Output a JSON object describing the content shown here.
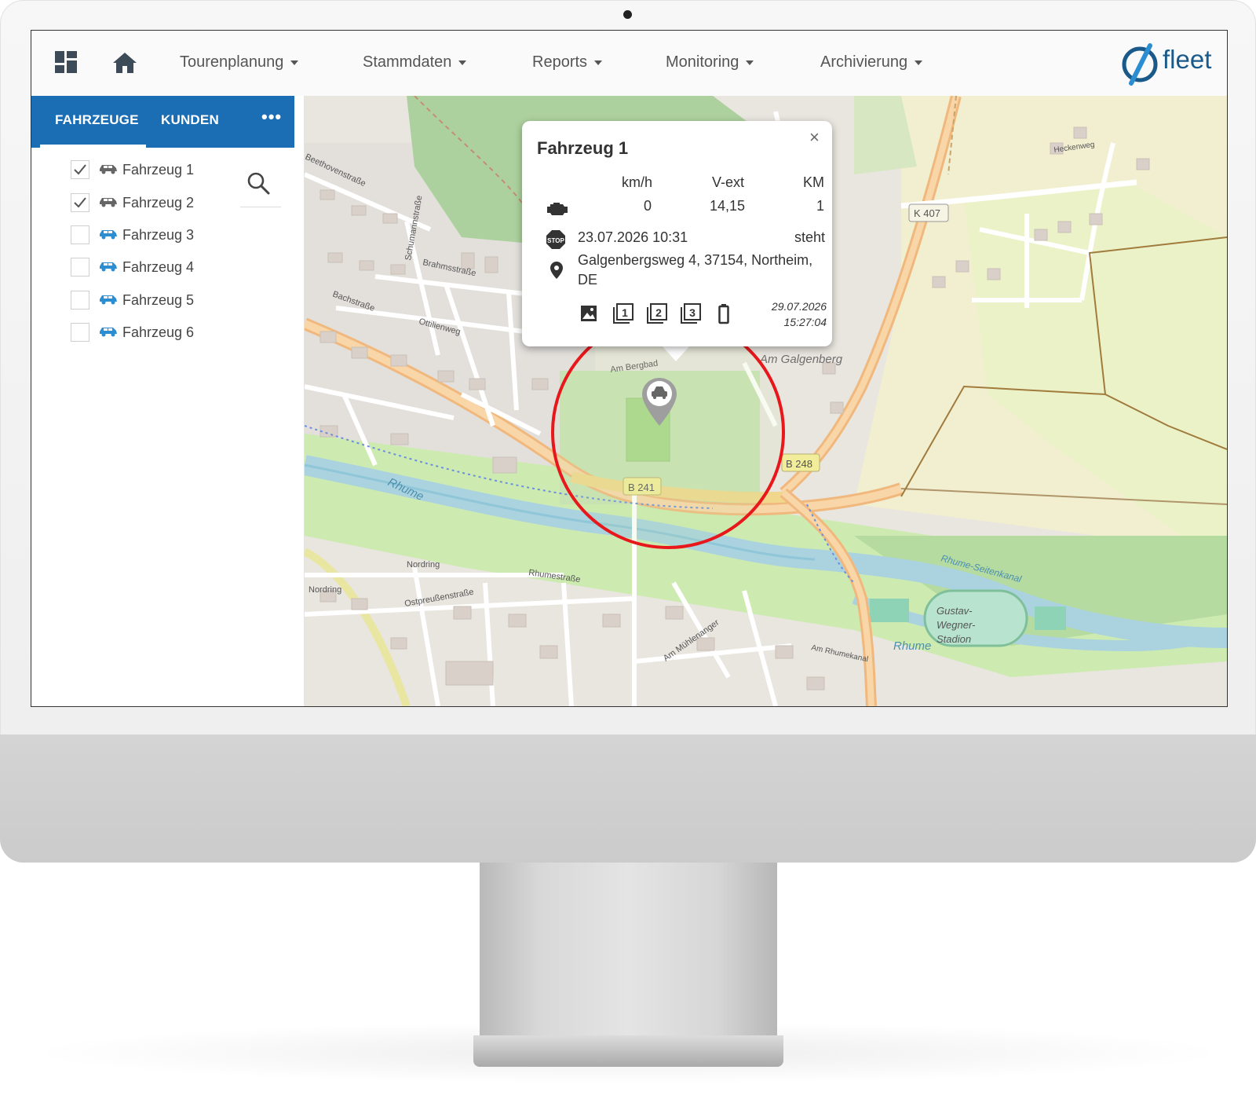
{
  "nav": {
    "items": [
      {
        "label": "Tourenplanung"
      },
      {
        "label": "Stammdaten"
      },
      {
        "label": "Reports"
      },
      {
        "label": "Monitoring"
      },
      {
        "label": "Archivierung"
      }
    ],
    "logo_text": "fleet"
  },
  "sidebar": {
    "tabs": {
      "vehicles": "FAHRZEUGE",
      "customers": "KUNDEN",
      "more": "•••"
    },
    "vehicles": [
      {
        "label": "Fahrzeug 1",
        "checked": true,
        "icon": "car-icon-gray"
      },
      {
        "label": "Fahrzeug 2",
        "checked": true,
        "icon": "car-icon-gray"
      },
      {
        "label": "Fahrzeug 3",
        "checked": false,
        "icon": "car-icon-blue"
      },
      {
        "label": "Fahrzeug 4",
        "checked": false,
        "icon": "car-icon-blue"
      },
      {
        "label": "Fahrzeug 5",
        "checked": false,
        "icon": "car-icon-blue"
      },
      {
        "label": "Fahrzeug 6",
        "checked": false,
        "icon": "car-icon-blue"
      }
    ]
  },
  "popup": {
    "title": "Fahrzeug 1",
    "close": "×",
    "headers": {
      "speed": "km/h",
      "vext": "V-ext",
      "km": "KM"
    },
    "values": {
      "speed": "0",
      "vext": "14,15",
      "km": "1"
    },
    "stop_time": "23.07.2026 10:31",
    "status": "steht",
    "address_line1": "Galgenbergsweg 4, 37154, Northeim,",
    "address_line2": "DE",
    "update_date": "29.07.2026",
    "update_time": "15:27:04"
  },
  "map": {
    "labels": {
      "b241": "B 241",
      "b248": "B 248",
      "k407": "K 407",
      "am_galgenberg": "Am Galgenberg",
      "rhume": "Rhume",
      "rhume2": "Rhume",
      "rhume_kanal": "Rhume-Seitenkanal",
      "stadion1": "Gustav-",
      "stadion2": "Wegner-",
      "stadion3": "Stadion",
      "beethoven": "Beethovenstraße",
      "brahms": "Brahmsstraße",
      "bach": "Bachstraße",
      "ottilien": "Ottilienweg",
      "schumann": "Schumannstraße",
      "nordring": "Nordring",
      "nordring2": "Nordring",
      "ostpreussen": "Ostpreußenstraße",
      "rhumestr": "Rhumestraße",
      "heckenweg": "Heckenweg",
      "am_bergbad": "Am Bergbad",
      "am_muehlenanger": "Am Mühlenanger",
      "am_rhumekanal": "Am Rhumekanal"
    },
    "colors": {
      "geofence": "#e8171c",
      "road": "#f6c58f",
      "park": "#c8e8c0",
      "water": "#aad3df"
    }
  }
}
